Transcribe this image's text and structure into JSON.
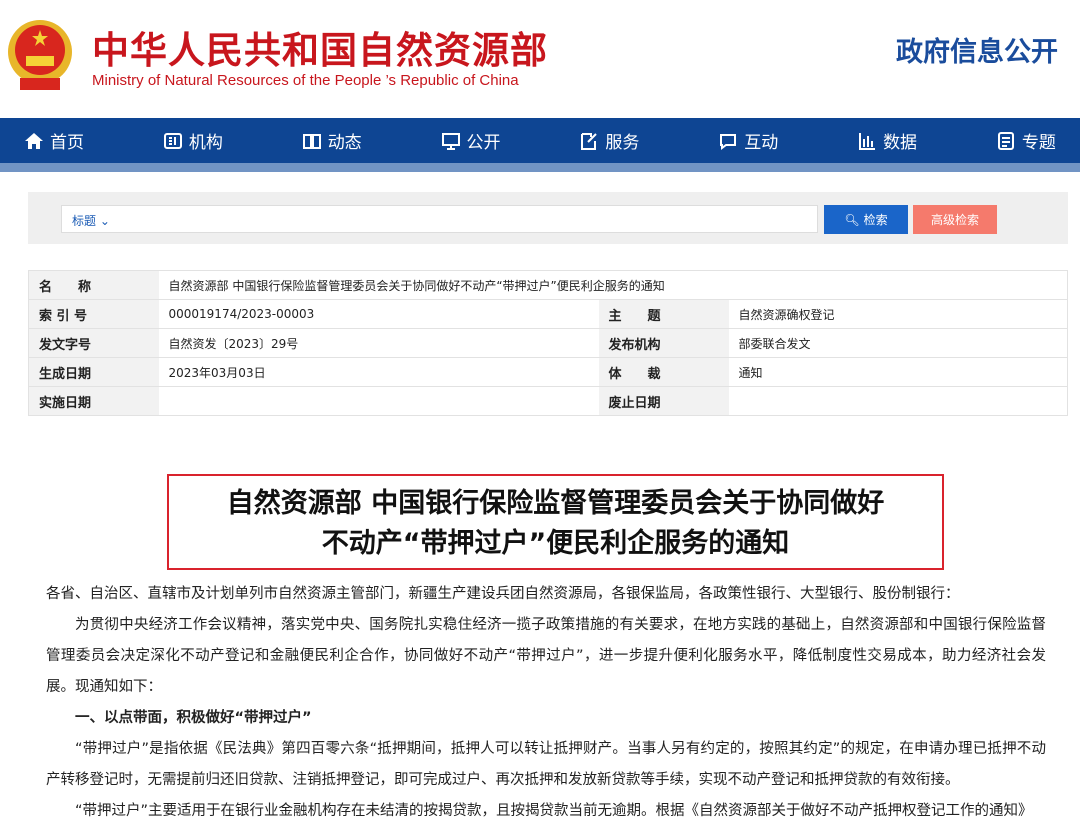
{
  "header": {
    "title_cn": "中华人民共和国自然资源部",
    "title_en": "Ministry of Natural Resources of the People ’s Republic of China",
    "gov_info": "政府信息公开"
  },
  "nav": [
    {
      "label": "首页",
      "icon": "home-icon"
    },
    {
      "label": "机构",
      "icon": "organization-icon"
    },
    {
      "label": "动态",
      "icon": "book-icon"
    },
    {
      "label": "公开",
      "icon": "monitor-icon"
    },
    {
      "label": "服务",
      "icon": "edit-icon"
    },
    {
      "label": "互动",
      "icon": "chat-icon"
    },
    {
      "label": "数据",
      "icon": "bar-chart-icon"
    },
    {
      "label": "专题",
      "icon": "topic-icon"
    }
  ],
  "search": {
    "field_select": "标题",
    "search_button": "检索",
    "advanced_button": "高级检索"
  },
  "meta": {
    "name_label": "名　　称",
    "name_value": "自然资源部 中国银行保险监督管理委员会关于协同做好不动产“带押过户”便民利企服务的通知",
    "index_label": "索 引 号",
    "index_value": "000019174/2023-00003",
    "topic_label": "主　　题",
    "topic_value": "自然资源确权登记",
    "docno_label": "发文字号",
    "docno_value": "自然资发〔2023〕29号",
    "publisher_label": "发布机构",
    "publisher_value": "部委联合发文",
    "date_label": "生成日期",
    "date_value": "2023年03月03日",
    "genre_label": "体　　裁",
    "genre_value": "通知",
    "effective_label": "实施日期",
    "effective_value": "",
    "abolish_label": "废止日期",
    "abolish_value": ""
  },
  "doc": {
    "title_line1": "自然资源部 中国银行保险监督管理委员会关于协同做好",
    "title_line2": "不动产“带押过户”便民利企服务的通知",
    "p1": "各省、自治区、直辖市及计划单列市自然资源主管部门，新疆生产建设兵团自然资源局，各银保监局，各政策性银行、大型银行、股份制银行：",
    "p2": "为贯彻中央经济工作会议精神，落实党中央、国务院扎实稳住经济一揽子政策措施的有关要求，在地方实践的基础上，自然资源部和中国银行保险监督管理委员会决定深化不动产登记和金融便民利企合作，协同做好不动产“带押过户”，进一步提升便利化服务水平，降低制度性交易成本，助力经济社会发展。现通知如下：",
    "h1": "一、以点带面，积极做好“带押过户”",
    "p3": "“带押过户”是指依据《民法典》第四百零六条“抵押期间，抵押人可以转让抵押财产。当事人另有约定的，按照其约定”的规定，在申请办理已抵押不动产转移登记时，无需提前归还旧贷款、注销抵押登记，即可完成过户、再次抵押和发放新贷款等手续，实现不动产登记和抵押贷款的有效衔接。",
    "p4": "“带押过户”主要适用于在银行业金融机构存在未结清的按揭贷款，且按揭贷款当前无逾期。根据《自然资源部关于做好不动产抵押权登记工作的通知》"
  }
}
